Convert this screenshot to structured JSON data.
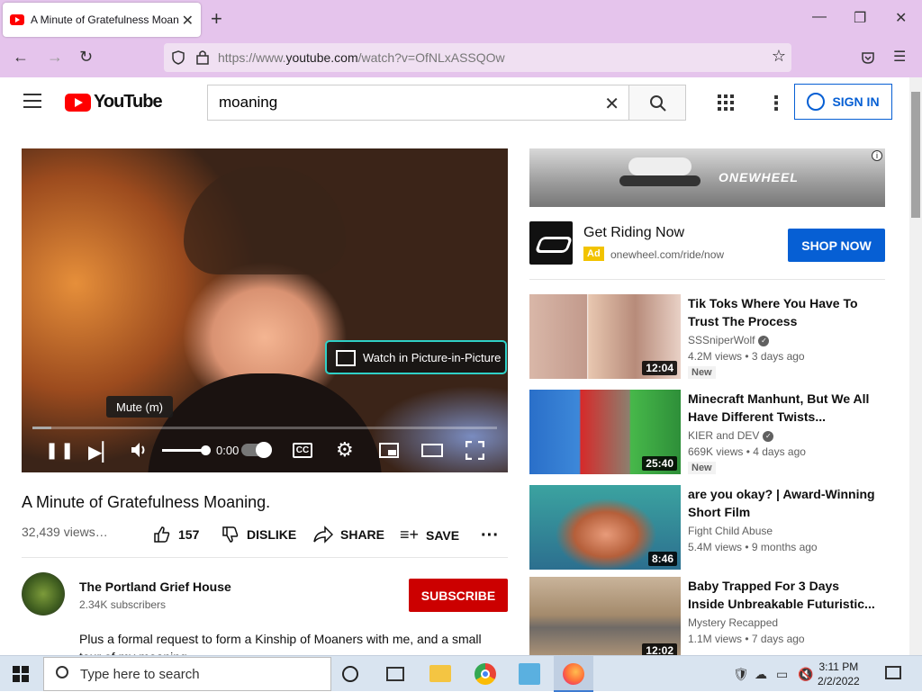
{
  "browser": {
    "tab_title": "A Minute of Gratefulness Moan",
    "url_prefix": "https://www.",
    "url_domain": "youtube.com",
    "url_path": "/watch?v=OfNLxASSQOw"
  },
  "youtube": {
    "logo_text": "YouTube",
    "search_value": "moaning",
    "sign_in": "SIGN IN"
  },
  "player": {
    "pip_label": "Watch in Picture-in-Picture",
    "tooltip": "Mute (m)",
    "time": "0:00",
    "progress_fraction": 0.04,
    "cc": "CC"
  },
  "video": {
    "title": "A Minute of Gratefulness Moaning.",
    "views": "32,439 views…",
    "likes": "157",
    "dislike": "DISLIKE",
    "share": "SHARE",
    "save": "SAVE",
    "channel_name": "The Portland Grief House",
    "subscribers": "2.34K subscribers",
    "subscribe": "SUBSCRIBE",
    "description": "Plus a formal request to form a Kinship of Moaners with me, and a small tour of my moaning..."
  },
  "ad": {
    "banner_brand": "ONEWHEEL",
    "title": "Get Riding Now",
    "badge": "Ad",
    "url": "onewheel.com/ride/now",
    "cta": "SHOP NOW"
  },
  "recommendations": [
    {
      "title": "Tik Toks Where You Have To Trust The Process",
      "channel": "SSSniperWolf",
      "meta": "4.2M views • 3 days ago",
      "badge": "New",
      "duration": "12:04"
    },
    {
      "title": "Minecraft Manhunt, But We All Have Different Twists...",
      "channel": "KIER and DEV",
      "meta": "669K views • 4 days ago",
      "badge": "New",
      "duration": "25:40"
    },
    {
      "title": "are you okay? | Award-Winning Short Film",
      "channel": "Fight Child Abuse",
      "meta": "5.4M views • 9 months ago",
      "duration": "8:46"
    },
    {
      "title": "Baby Trapped For 3 Days Inside Unbreakable Futuristic...",
      "channel": "Mystery Recapped",
      "meta": "1.1M views • 7 days ago",
      "duration": "12:02"
    }
  ],
  "taskbar": {
    "search_placeholder": "Type here to search",
    "time": "3:11 PM",
    "date": "2/2/2022"
  }
}
